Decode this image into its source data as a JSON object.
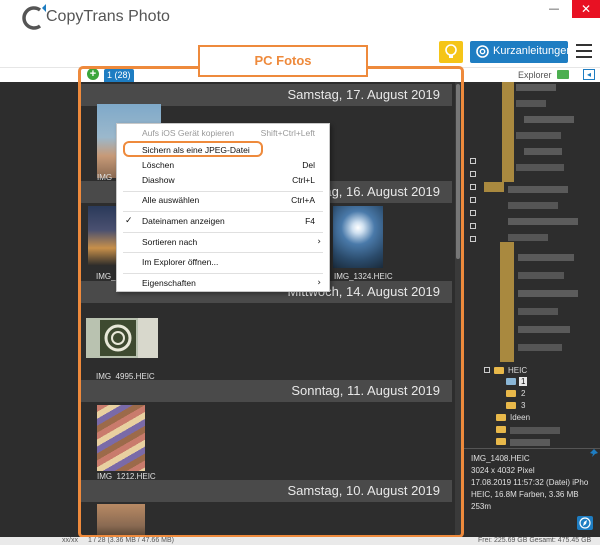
{
  "app": {
    "title": "CopyTrans Photo",
    "logo_letter": "C"
  },
  "window_controls": {
    "minimize": "—",
    "close": "✕"
  },
  "toolbar": {
    "help_label": "Kurzanleitungen"
  },
  "annotation": {
    "label": "PC Fotos"
  },
  "photos": {
    "count_tab": "1 (28)",
    "groups": [
      {
        "date": "Samstag, 17. August 2019",
        "thumbs": [
          {
            "label": "IMG_1408"
          }
        ]
      },
      {
        "date": "Freitag, 16. August 2019",
        "thumbs": [
          {
            "label": "IMG_1..."
          },
          {
            "label": "IMG_1324.HEIC"
          }
        ]
      },
      {
        "date": "Mittwoch, 14. August 2019",
        "thumbs": [
          {
            "label": "IMG_4995.HEIC"
          }
        ]
      },
      {
        "date": "Sonntag, 11. August 2019",
        "thumbs": [
          {
            "label": "IMG_1212.HEIC"
          }
        ]
      },
      {
        "date": "Samstag, 10. August 2019",
        "thumbs": []
      }
    ]
  },
  "context_menu": {
    "items": [
      {
        "label": "Aufs iOS Gerät kopieren",
        "shortcut": "Shift+Ctrl+Left",
        "disabled": true
      },
      {
        "label": "Sichern als eine JPEG-Datei",
        "shortcut": ""
      },
      {
        "label": "Löschen",
        "shortcut": "Del"
      },
      {
        "label": "Diashow",
        "shortcut": "Ctrl+L"
      },
      {
        "label": "Alle auswählen",
        "shortcut": "Ctrl+A"
      },
      {
        "label": "Dateinamen anzeigen",
        "shortcut": "F4",
        "checked": true
      },
      {
        "label": "Sortieren nach",
        "submenu": true
      },
      {
        "label": "Im Explorer öffnen...",
        "shortcut": ""
      },
      {
        "label": "Eigenschaften",
        "submenu": true
      }
    ],
    "check_mark": "✓",
    "submenu_arrow": "›"
  },
  "explorer": {
    "title": "Explorer",
    "collapse_glyph": "◂",
    "tree": {
      "heic": "HEIC",
      "sub1": "1",
      "sub2": "2",
      "sub3": "3",
      "ideen": "Ideen"
    }
  },
  "info": {
    "filename": "IMG_1408.HEIC",
    "dimensions": "3024 x 4032 Pixel",
    "date": "17.08.2019 11:57:32  (Datei) iPho",
    "format": "HEIC, 16.8M Farben, 3.36 MB",
    "length": "253m"
  },
  "statusbar": {
    "left": "xx/xx",
    "middle": "1 / 28 (3.36 MB / 47.66 MB)",
    "right": "Frei: 225.69 GB Gesamt: 475.45 GB"
  },
  "colors": {
    "accent_blue": "#1e7dc2",
    "annotation_orange": "#ee8a3c",
    "dark_bg": "#2d2d2d",
    "bulb_yellow": "#f5c518"
  },
  "icons": [
    "logo-icon",
    "lightbulb-icon",
    "lifebuoy-icon",
    "hamburger-icon",
    "add-icon",
    "folder-icon",
    "collapse-icon",
    "pin-icon",
    "compass-icon"
  ]
}
